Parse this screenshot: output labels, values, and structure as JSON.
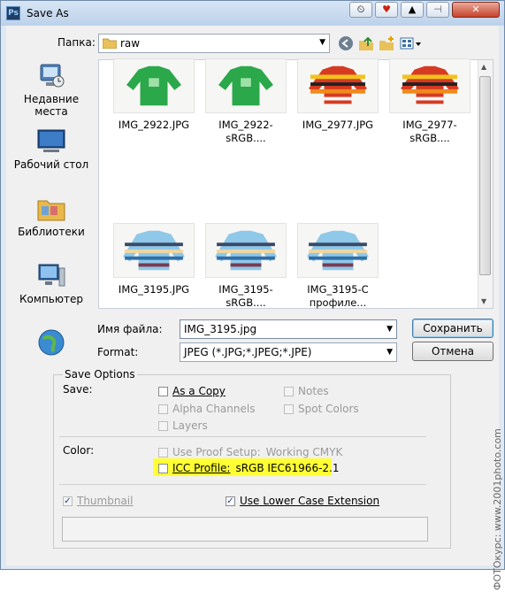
{
  "window": {
    "title": "Save As",
    "accent": "#3c7fb1"
  },
  "location": {
    "label": "Папка:",
    "folder": "raw",
    "icon": "folder-icon"
  },
  "nav": {
    "icons": [
      "back-icon",
      "up-folder-icon",
      "new-folder-icon",
      "view-menu-icon"
    ]
  },
  "sidebar": {
    "items": [
      {
        "label": "Недавние места",
        "icon": "recent-places-icon"
      },
      {
        "label": "Рабочий стол",
        "icon": "desktop-icon"
      },
      {
        "label": "Библиотеки",
        "icon": "libraries-icon"
      },
      {
        "label": "Компьютер",
        "icon": "computer-icon"
      },
      {
        "label": "",
        "icon": "network-icon"
      }
    ]
  },
  "files": [
    {
      "name": "IMG_2922.JPG",
      "kind": "green-shirt"
    },
    {
      "name": "IMG_2922-sRGB....",
      "kind": "green-shirt"
    },
    {
      "name": "IMG_2977.JPG",
      "kind": "striped-sweater"
    },
    {
      "name": "IMG_2977-sRGB....",
      "kind": "striped-sweater"
    },
    {
      "name": "IMG_3195.JPG",
      "kind": "blue-sweater"
    },
    {
      "name": "IMG_3195-sRGB....",
      "kind": "blue-sweater"
    },
    {
      "name": "IMG_3195-C профиле...",
      "kind": "blue-sweater"
    }
  ],
  "filename": {
    "label": "Имя файла:",
    "value": "IMG_3195.jpg"
  },
  "format": {
    "label": "Format:",
    "value": "JPEG (*.JPG;*.JPEG;*.JPE)"
  },
  "buttons": {
    "save": "Сохранить",
    "cancel": "Отмена"
  },
  "save_options": {
    "title": "Save Options",
    "save_label": "Save:",
    "as_a_copy": "As a Copy",
    "notes": "Notes",
    "alpha_channels": "Alpha Channels",
    "spot_colors": "Spot Colors",
    "layers": "Layers",
    "color_label": "Color:",
    "use_proof_setup": "Use Proof Setup:",
    "proof_value": "Working CMYK",
    "icc_profile": "ICC Profile:",
    "icc_value": "sRGB IEC61966-2.1",
    "thumbnail": "Thumbnail",
    "lower_case": "Use Lower Case Extension"
  },
  "watermark": "ФОТОкурс: www.2001photo.com"
}
